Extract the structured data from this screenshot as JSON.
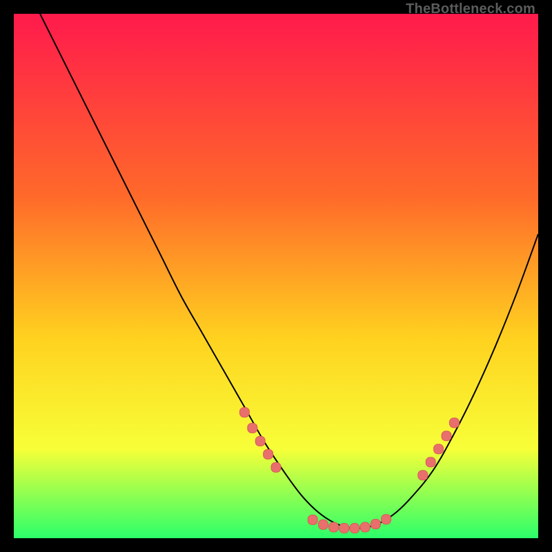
{
  "watermark": "TheBottleneck.com",
  "colors": {
    "page_bg": "#000000",
    "grad_top": "#ff1a4c",
    "grad_mid1": "#ff6a2a",
    "grad_mid2": "#ffd21f",
    "grad_mid3": "#f7ff38",
    "grad_bottom": "#2bff6a",
    "curve": "#000000",
    "marker_fill": "#e96f6c",
    "marker_stroke": "#d85b57",
    "watermark": "#5c5c5c"
  },
  "chart_data": {
    "type": "line",
    "title": "",
    "xlabel": "",
    "ylabel": "",
    "xlim": [
      0,
      100
    ],
    "ylim": [
      0,
      100
    ],
    "grid": false,
    "legend": false,
    "series": [
      {
        "name": "bottleneck-curve",
        "x": [
          5,
          8,
          12,
          16,
          20,
          24,
          28,
          32,
          36,
          40,
          44,
          48,
          52,
          55,
          58,
          61,
          64,
          67,
          70,
          73,
          76,
          80,
          84,
          88,
          92,
          96,
          100
        ],
        "y": [
          100,
          94,
          86,
          78,
          70,
          62,
          54,
          46,
          39,
          32,
          25,
          18,
          12,
          8,
          5,
          3,
          2,
          2,
          3,
          5,
          8,
          13,
          20,
          28,
          37,
          47,
          58
        ]
      }
    ],
    "annotations": {
      "marker_segments": [
        {
          "name": "left-descent-markers",
          "points": [
            {
              "x": 44,
              "y": 24
            },
            {
              "x": 45.5,
              "y": 21
            },
            {
              "x": 47,
              "y": 18.5
            },
            {
              "x": 48.5,
              "y": 16
            },
            {
              "x": 50,
              "y": 13.5
            }
          ]
        },
        {
          "name": "valley-floor-markers",
          "points": [
            {
              "x": 57,
              "y": 3.5
            },
            {
              "x": 59,
              "y": 2.6
            },
            {
              "x": 61,
              "y": 2.1
            },
            {
              "x": 63,
              "y": 1.9
            },
            {
              "x": 65,
              "y": 1.9
            },
            {
              "x": 67,
              "y": 2.1
            },
            {
              "x": 69,
              "y": 2.7
            },
            {
              "x": 71,
              "y": 3.6
            }
          ]
        },
        {
          "name": "right-ascent-markers",
          "points": [
            {
              "x": 78,
              "y": 12
            },
            {
              "x": 79.5,
              "y": 14.5
            },
            {
              "x": 81,
              "y": 17
            },
            {
              "x": 82.5,
              "y": 19.5
            },
            {
              "x": 84,
              "y": 22
            }
          ]
        }
      ]
    }
  }
}
